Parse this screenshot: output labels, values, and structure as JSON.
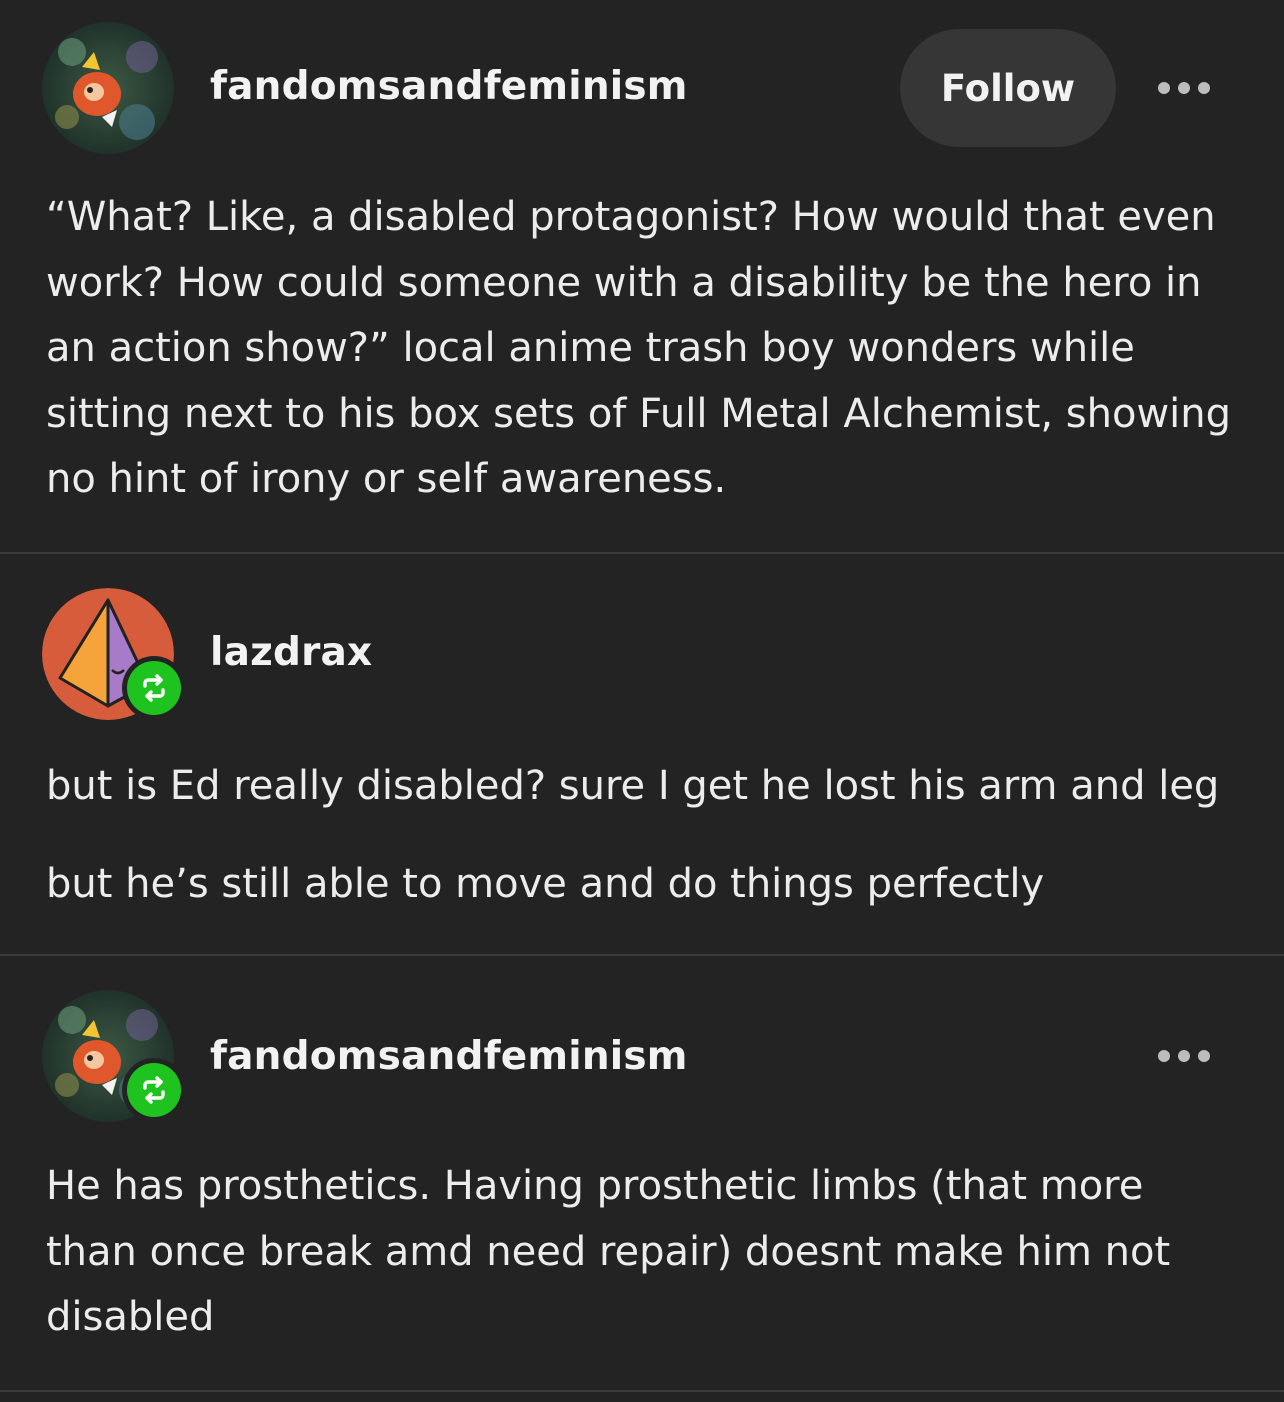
{
  "posts": [
    {
      "username": "fandomsandfeminism",
      "follow_label": "Follow",
      "more_icon": "more-horizontal-icon",
      "body": "“What? Like, a disabled protagonist? How would that even work? How could someone with a disability be the hero in an action show?” local anime trash boy wonders while sitting next to his box sets of Full Metal Alchemist, showing no hint of irony or self awareness."
    },
    {
      "username": "lazdrax",
      "badge_icon": "reblog-icon",
      "paragraphs": [
        "but is Ed really disabled? sure I get he lost his arm and leg",
        "but he’s still able to move and do things perfectly"
      ]
    },
    {
      "username": "fandomsandfeminism",
      "badge_icon": "reblog-icon",
      "more_icon": "more-horizontal-icon",
      "body": "He has prosthetics.  Having prosthetic limbs (that more than once break amd need repair) doesnt make him not disabled"
    }
  ],
  "colors": {
    "background": "#232323",
    "reblog_badge": "#1fc31f",
    "follow_button": "#363636",
    "divider": "#3a3a3a"
  }
}
